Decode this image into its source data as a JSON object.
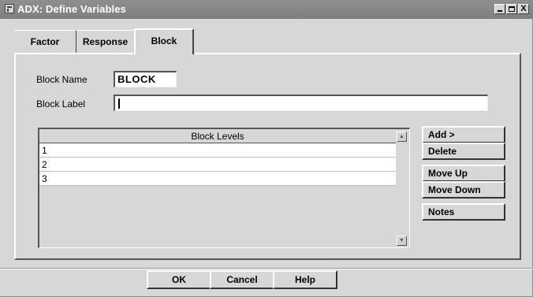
{
  "window": {
    "title": "ADX: Define Variables",
    "controls": {
      "minimize": "_",
      "maximize": "□",
      "close": "X"
    },
    "icon": "app-window-icon"
  },
  "tabs": [
    {
      "label": "Factor",
      "selected": false
    },
    {
      "label": "Response",
      "selected": false
    },
    {
      "label": "Block",
      "selected": true
    }
  ],
  "form": {
    "block_name_label": "Block Name",
    "block_name_value": "BLOCK",
    "block_label_label": "Block Label",
    "block_label_value": ""
  },
  "levels": {
    "header": "Block Levels",
    "rows": [
      "1",
      "2",
      "3"
    ],
    "scroll_up": "▲",
    "scroll_down": "▼"
  },
  "side_buttons": {
    "add": "Add >",
    "delete": "Delete",
    "move_up": "Move Up",
    "move_down": "Move Down",
    "notes": "Notes"
  },
  "footer": {
    "ok": "OK",
    "cancel": "Cancel",
    "help": "Help"
  },
  "colors": {
    "titlebar": "#8a8a8a",
    "face": "#d7d7d7",
    "field": "#ffffff"
  }
}
